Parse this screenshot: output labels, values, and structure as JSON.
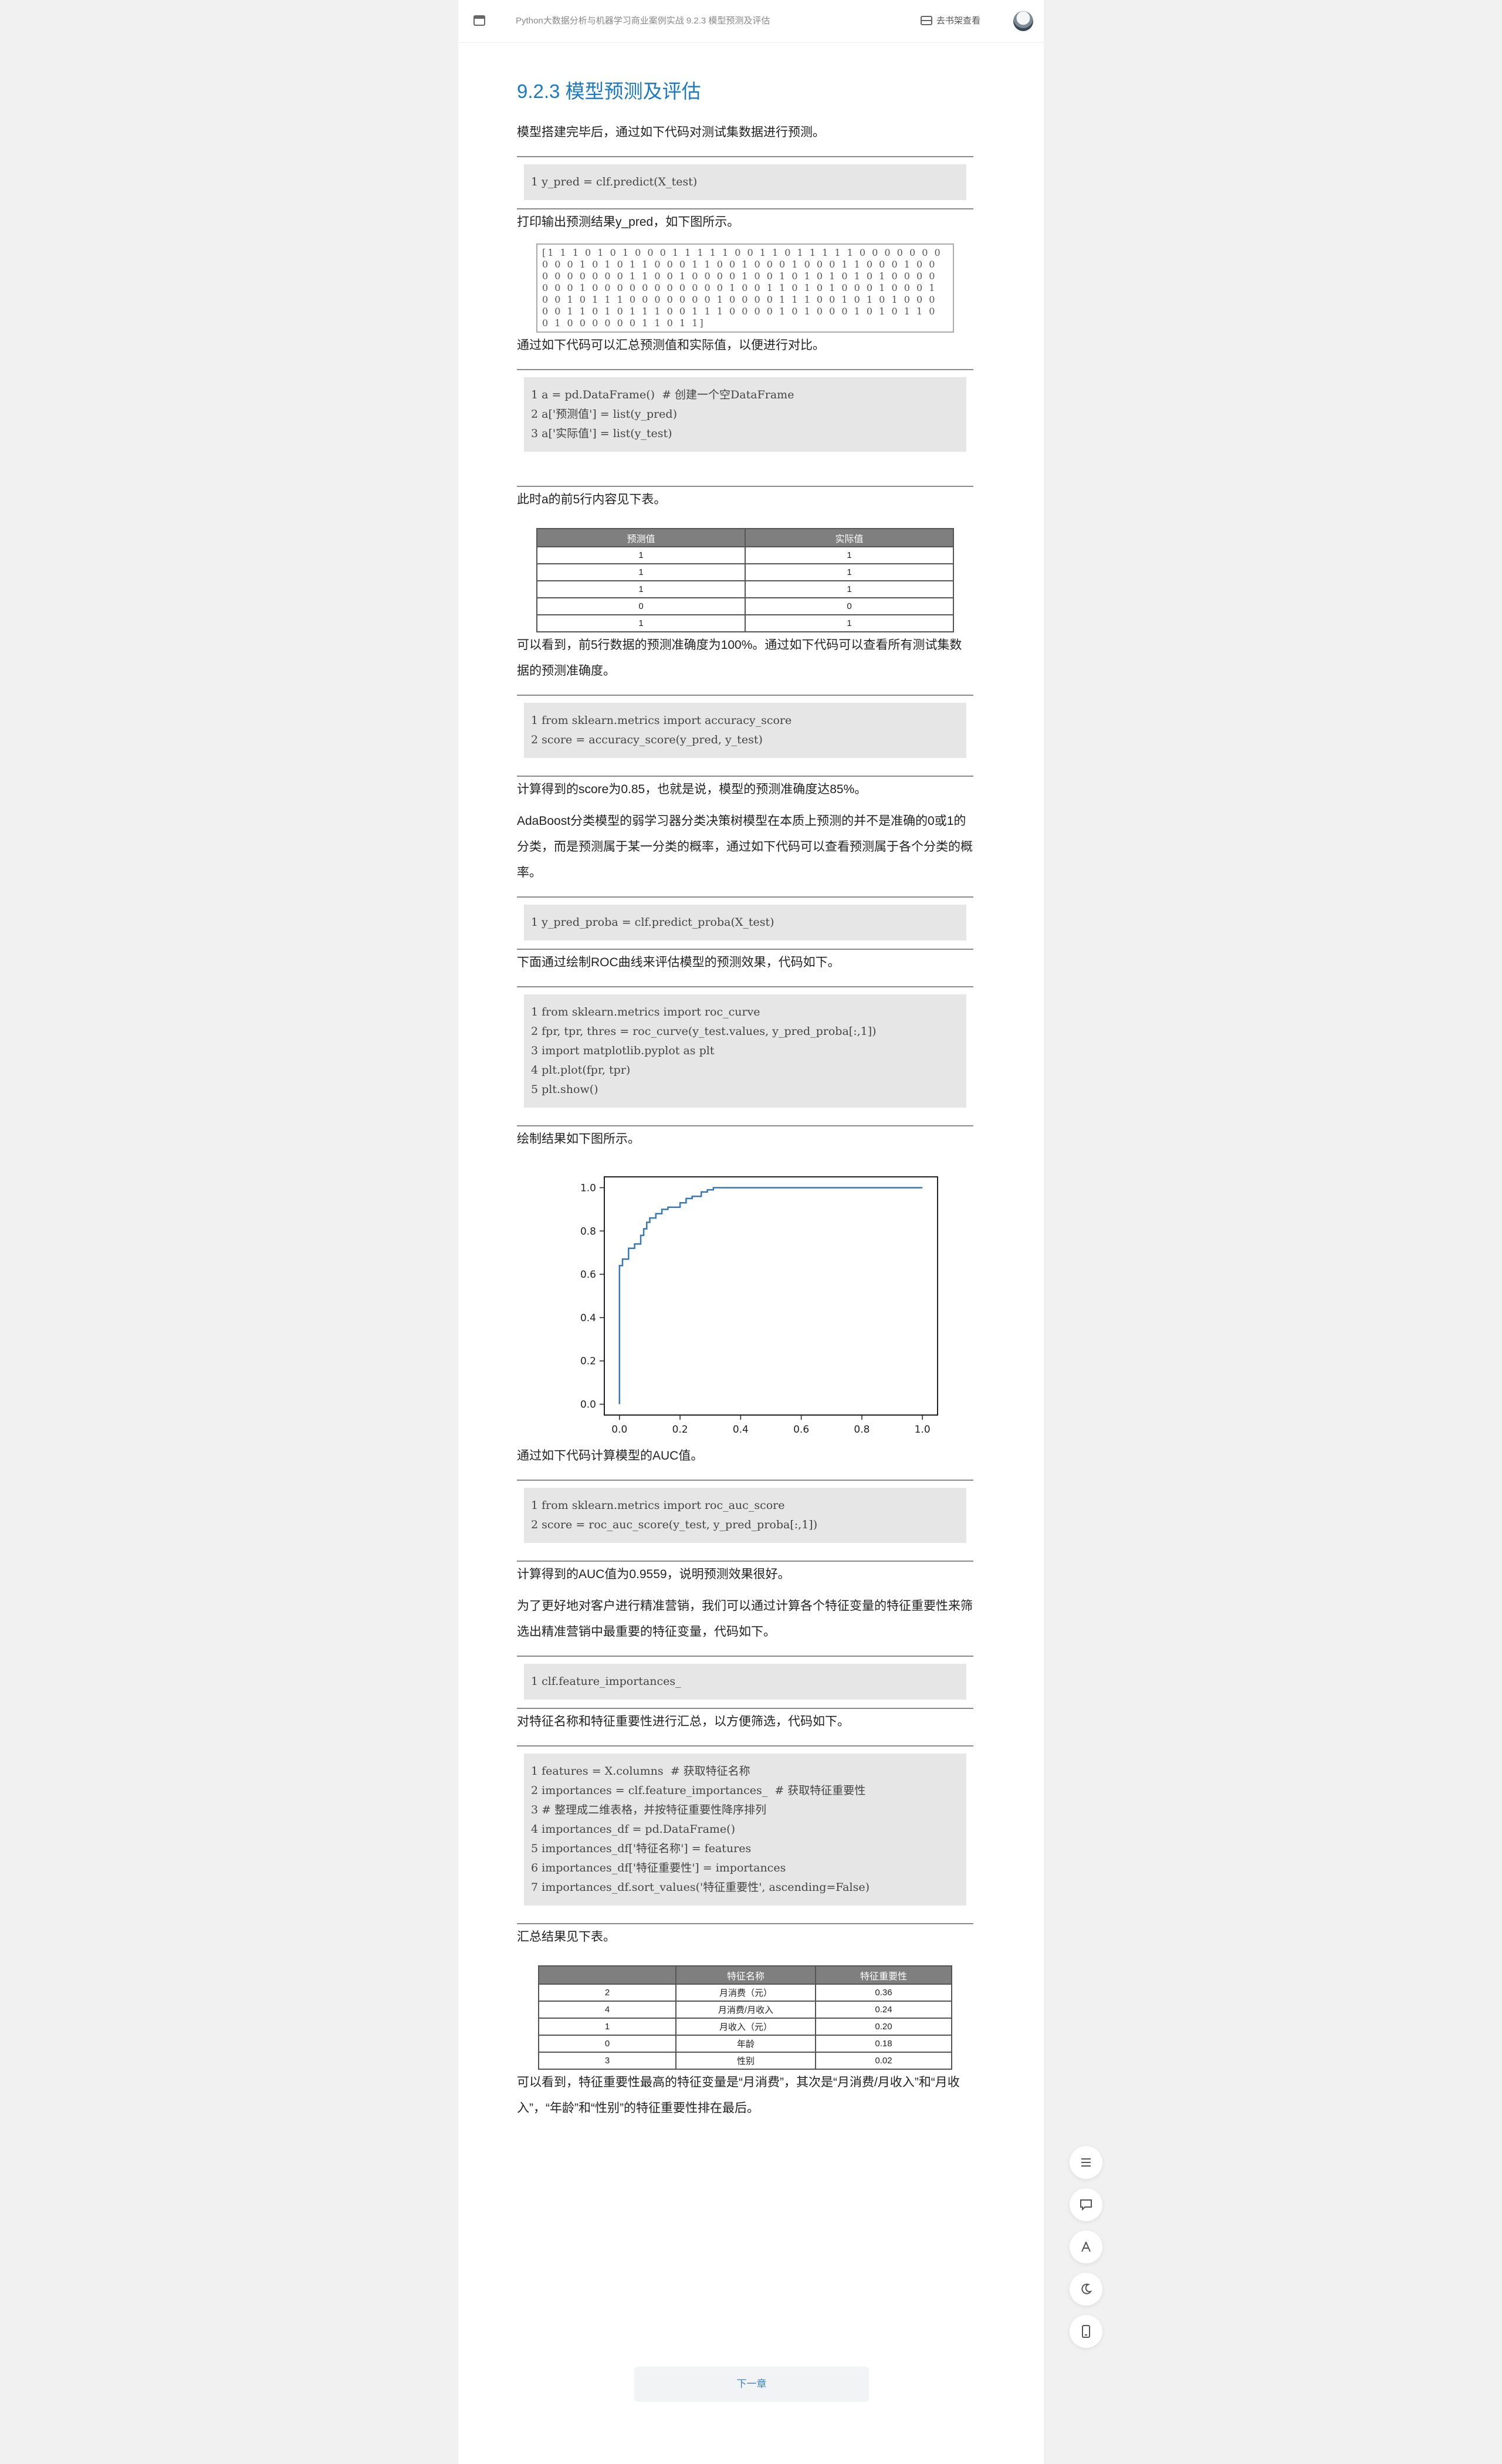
{
  "topbar": {
    "breadcrumb": "Python大数据分析与机器学习商业案例实战 9.2.3 模型预测及评估",
    "bookshelf_label": "去书架查看"
  },
  "section_title": "9.2.3 模型预测及评估",
  "paragraphs": {
    "p1": "模型搭建完毕后，通过如下代码对测试集数据进行预测。",
    "p2": "打印输出预测结果y_pred，如下图所示。",
    "p3": "通过如下代码可以汇总预测值和实际值，以便进行对比。",
    "p4": "此时a的前5行内容见下表。",
    "p5": "可以看到，前5行数据的预测准确度为100%。通过如下代码可以查看所有测试集数据的预测准确度。",
    "p6": "计算得到的score为0.85，也就是说，模型的预测准确度达85%。",
    "p7": "AdaBoost分类模型的弱学习器分类决策树模型在本质上预测的并不是准确的0或1的分类，而是预测属于某一分类的概率，通过如下代码可以查看预测属于各个分类的概率。",
    "p8": "下面通过绘制ROC曲线来评估模型的预测效果，代码如下。",
    "p9": "绘制结果如下图所示。",
    "p10": "通过如下代码计算模型的AUC值。",
    "p11": "计算得到的AUC值为0.9559，说明预测效果很好。",
    "p12": "为了更好地对客户进行精准营销，我们可以通过计算各个特征变量的特征重要性来筛选出精准营销中最重要的特征变量，代码如下。",
    "p13": "对特征名称和特征重要性进行汇总，以方便筛选，代码如下。",
    "p14": "汇总结果见下表。",
    "p15": "可以看到，特征重要性最高的特征变量是“月消费”，其次是“月消费/月收入”和“月收入”，“年龄”和“性别”的特征重要性排在最后。"
  },
  "code": {
    "c1": "1 y_pred = clf.predict(X_test)",
    "c2": "1 a = pd.DataFrame()  # 创建一个空DataFrame\n2 a['预测值'] = list(y_pred)\n3 a['实际值'] = list(y_test)",
    "c3": "1 from sklearn.metrics import accuracy_score\n2 score = accuracy_score(y_pred, y_test)",
    "c4": "1 y_pred_proba = clf.predict_proba(X_test)",
    "c5": "1 from sklearn.metrics import roc_curve\n2 fpr, tpr, thres = roc_curve(y_test.values, y_pred_proba[:,1])\n3 import matplotlib.pyplot as plt\n4 plt.plot(fpr, tpr)\n5 plt.show()",
    "c6": "1 from sklearn.metrics import roc_auc_score\n2 score = roc_auc_score(y_test, y_pred_proba[:,1])",
    "c7": "1 clf.feature_importances_",
    "c8": "1 features = X.columns  # 获取特征名称\n2 importances = clf.feature_importances_  # 获取特征重要性\n3 # 整理成二维表格，并按特征重要性降序排列\n4 importances_df = pd.DataFrame()\n5 importances_df['特征名称'] = features\n6 importances_df['特征重要性'] = importances\n7 importances_df.sort_values('特征重要性', ascending=False)"
  },
  "y_pred_output": "[1 1 1 0 1 0 1 0 0 0 1 1 1 1 1 0 0 1 1 0 1 1 1 1 1 0 0 0 0 0 0 0 0 0 0 1 0 1 0 1 1 0 0 0 1 1 0 0 1 0 0 0 1 0 0 0 1 1 0 0 0 1 0 0 0 0 0 0 0 0 0 1 1 0 0 1 0 0 0 0 1 0 0 1 0 1 0 1 0 1 0 1 0 0 0 0 0 0 0 1 0 0 0 0 0 0 0 0 0 0 0 1 0 0 1 1 0 1 0 1 0 0 0 1 0 0 0 1 0 0 1 0 1 1 1 0 0 0 0 0 0 0 1 0 0 0 0 1 1 1 0 0 1 0 1 0 1 0 0 0 0 0 1 1 0 1 0 1 1 1 0 0 1 1 1 0 0 0 0 1 0 1 0 0 0 1 0 1 0 1 1 0 0 1 0 0 0 0 0 0 1 1 0 1 1]",
  "table1": {
    "headers": [
      "预测值",
      "实际值"
    ],
    "rows": [
      [
        "1",
        "1"
      ],
      [
        "1",
        "1"
      ],
      [
        "1",
        "1"
      ],
      [
        "0",
        "0"
      ],
      [
        "1",
        "1"
      ]
    ]
  },
  "table2": {
    "headers": [
      "",
      "特征名称",
      "特征重要性"
    ],
    "rows": [
      [
        "2",
        "月消费（元）",
        "0.36"
      ],
      [
        "4",
        "月消费/月收入",
        "0.24"
      ],
      [
        "1",
        "月收入（元）",
        "0.20"
      ],
      [
        "0",
        "年龄",
        "0.18"
      ],
      [
        "3",
        "性别",
        "0.02"
      ]
    ]
  },
  "chart_data": {
    "type": "line",
    "title": "",
    "xlabel": "",
    "ylabel": "",
    "xlim": [
      -0.05,
      1.05
    ],
    "ylim": [
      -0.05,
      1.05
    ],
    "xticks": [
      "0.0",
      "0.2",
      "0.4",
      "0.6",
      "0.8",
      "1.0"
    ],
    "yticks": [
      "0.0",
      "0.2",
      "0.4",
      "0.6",
      "0.8",
      "1.0"
    ],
    "color": "#3a78b5",
    "series": [
      {
        "x": [
          0,
          0,
          0.01,
          0.01,
          0.03,
          0.03,
          0.05,
          0.05,
          0.07,
          0.07,
          0.08,
          0.08,
          0.09,
          0.09,
          0.1,
          0.1,
          0.12,
          0.12,
          0.14,
          0.14,
          0.16,
          0.16,
          0.2,
          0.2,
          0.22,
          0.22,
          0.24,
          0.24,
          0.27,
          0.27,
          0.29,
          0.29,
          0.31,
          0.31,
          1.0
        ],
        "y": [
          0,
          0.64,
          0.64,
          0.67,
          0.67,
          0.72,
          0.72,
          0.74,
          0.74,
          0.78,
          0.78,
          0.81,
          0.81,
          0.84,
          0.84,
          0.86,
          0.86,
          0.88,
          0.88,
          0.9,
          0.9,
          0.91,
          0.91,
          0.93,
          0.93,
          0.95,
          0.95,
          0.96,
          0.96,
          0.98,
          0.98,
          0.99,
          0.99,
          1.0,
          1.0
        ]
      }
    ]
  },
  "buttons": {
    "next": "下一章"
  },
  "float_icons": [
    "list-icon",
    "comment-icon",
    "font-icon",
    "night-mode-icon",
    "phone-icon"
  ]
}
